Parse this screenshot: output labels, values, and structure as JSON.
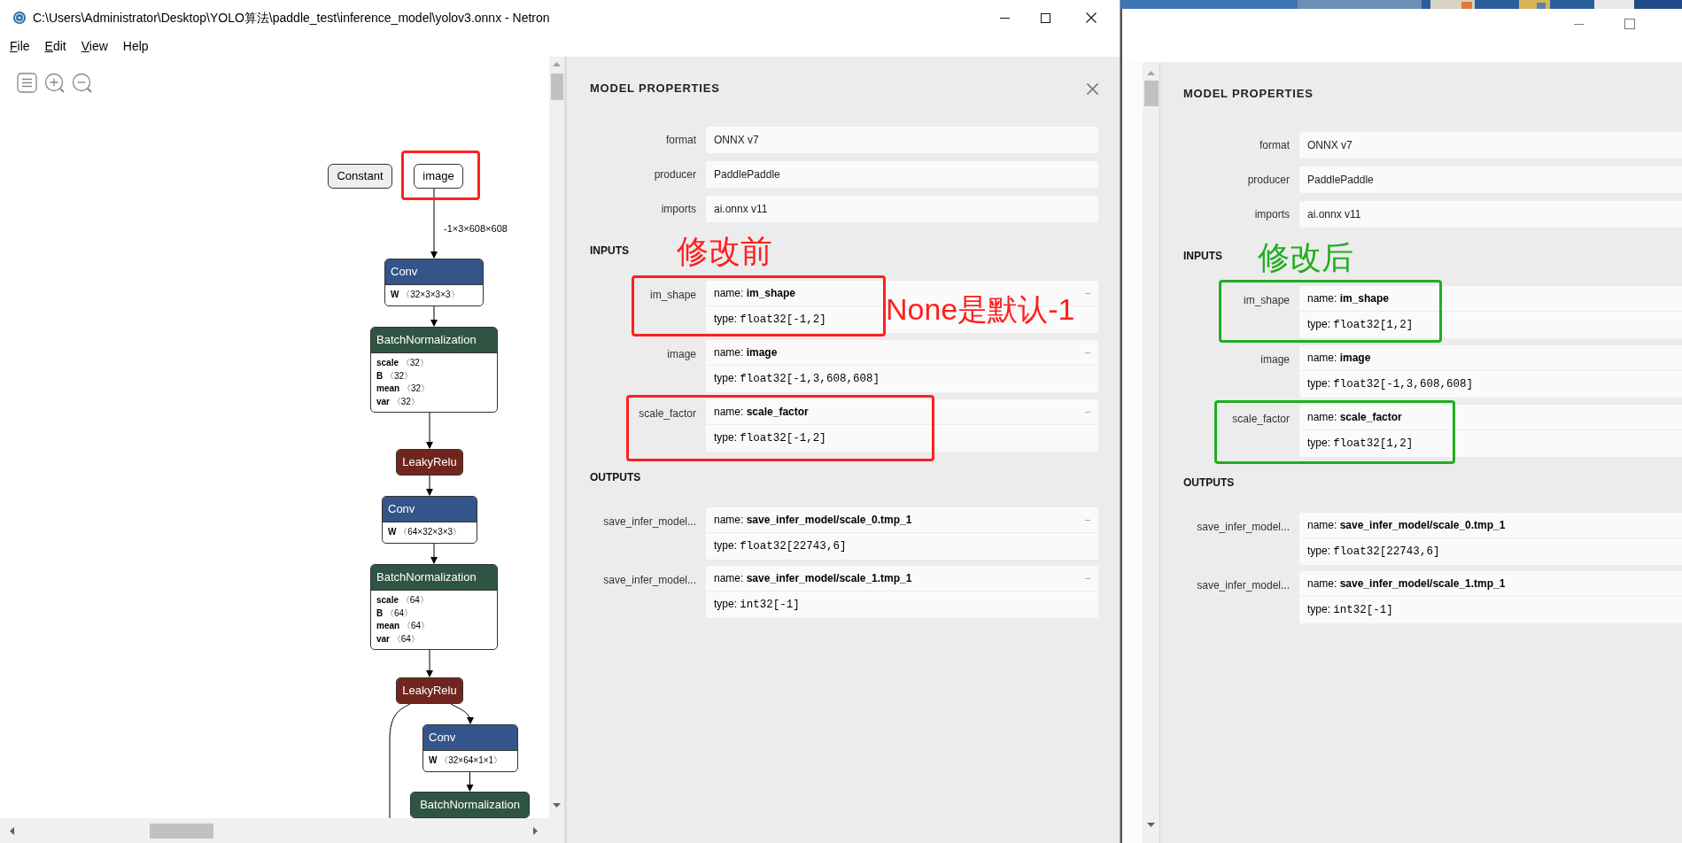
{
  "left_window": {
    "title": "C:\\Users\\Administrator\\Desktop\\YOLO算法\\paddle_test\\inference_model\\yolov3.onnx - Netron",
    "menu": [
      {
        "label": "File",
        "underlined": true
      },
      {
        "label": "Edit",
        "underlined": true
      },
      {
        "label": "View",
        "underlined": true
      },
      {
        "label": "Help",
        "underlined": false
      }
    ],
    "graph": {
      "nodes": [
        {
          "kind": "constant",
          "label": "Constant"
        },
        {
          "kind": "input",
          "label": "image",
          "output_label": "-1×3×608×608"
        },
        {
          "kind": "op",
          "color": "#34548a",
          "label": "Conv",
          "attributes": [
            {
              "name": "W",
              "value": "〈32×3×3×3〉"
            }
          ]
        },
        {
          "kind": "op",
          "color": "#2f5443",
          "label": "BatchNormalization",
          "attributes": [
            {
              "name": "scale",
              "value": "〈32〉"
            },
            {
              "name": "B",
              "value": "〈32〉"
            },
            {
              "name": "mean",
              "value": "〈32〉"
            },
            {
              "name": "var",
              "value": "〈32〉"
            }
          ]
        },
        {
          "kind": "op",
          "color": "#70261f",
          "label": "LeakyRelu"
        },
        {
          "kind": "op",
          "color": "#34548a",
          "label": "Conv",
          "attributes": [
            {
              "name": "W",
              "value": "〈64×32×3×3〉"
            }
          ]
        },
        {
          "kind": "op",
          "color": "#2f5443",
          "label": "BatchNormalization",
          "attributes": [
            {
              "name": "scale",
              "value": "〈64〉"
            },
            {
              "name": "B",
              "value": "〈64〉"
            },
            {
              "name": "mean",
              "value": "〈64〉"
            },
            {
              "name": "var",
              "value": "〈64〉"
            }
          ]
        },
        {
          "kind": "op",
          "color": "#70261f",
          "label": "LeakyRelu"
        },
        {
          "kind": "op",
          "color": "#34548a",
          "label": "Conv",
          "attributes": [
            {
              "name": "W",
              "value": "〈32×64×1×1〉"
            }
          ]
        },
        {
          "kind": "op",
          "color": "#2f5443",
          "label": "BatchNormalization"
        }
      ]
    },
    "properties": {
      "title": "MODEL PROPERTIES",
      "metadata": [
        {
          "label": "format",
          "value": "ONNX v7"
        },
        {
          "label": "producer",
          "value": "PaddlePaddle"
        },
        {
          "label": "imports",
          "value": "ai.onnx v11"
        }
      ],
      "inputs_heading": "INPUTS",
      "inputs": [
        {
          "label": "im_shape",
          "name_label": "name:",
          "name": "im_shape",
          "type_label": "type:",
          "type": "float32[-1,2]",
          "marked": true
        },
        {
          "label": "image",
          "name_label": "name:",
          "name": "image",
          "type_label": "type:",
          "type": "float32[-1,3,608,608]",
          "marked": false
        },
        {
          "label": "scale_factor",
          "name_label": "name:",
          "name": "scale_factor",
          "type_label": "type:",
          "type": "float32[-1,2]",
          "marked": true
        }
      ],
      "outputs_heading": "OUTPUTS",
      "outputs": [
        {
          "label": "save_infer_model...",
          "name_label": "name:",
          "name": "save_infer_model/scale_0.tmp_1",
          "type_label": "type:",
          "type": "float32[22743,6]"
        },
        {
          "label": "save_infer_model...",
          "name_label": "name:",
          "name": "save_infer_model/scale_1.tmp_1",
          "type_label": "type:",
          "type": "int32[-1]"
        }
      ]
    },
    "annotations": [
      {
        "kind": "text",
        "text": "修改前",
        "color": "#ff1f1f"
      },
      {
        "kind": "text",
        "text": "None是默认-1",
        "color": "#ff1f1f"
      },
      {
        "kind": "frame",
        "color": "#ff1f1f"
      }
    ]
  },
  "right_window": {
    "properties": {
      "title": "MODEL PROPERTIES",
      "metadata": [
        {
          "label": "format",
          "value": "ONNX v7"
        },
        {
          "label": "producer",
          "value": "PaddlePaddle"
        },
        {
          "label": "imports",
          "value": "ai.onnx v11"
        }
      ],
      "inputs_heading": "INPUTS",
      "inputs": [
        {
          "label": "im_shape",
          "name_label": "name:",
          "name": "im_shape",
          "type_label": "type:",
          "type": "float32[1,2]",
          "marked": true
        },
        {
          "label": "image",
          "name_label": "name:",
          "name": "image",
          "type_label": "type:",
          "type": "float32[-1,3,608,608]",
          "marked": false
        },
        {
          "label": "scale_factor",
          "name_label": "name:",
          "name": "scale_factor",
          "type_label": "type:",
          "type": "float32[1,2]",
          "marked": true
        }
      ],
      "outputs_heading": "OUTPUTS",
      "outputs": [
        {
          "label": "save_infer_model...",
          "name_label": "name:",
          "name": "save_infer_model/scale_0.tmp_1",
          "type_label": "type:",
          "type": "float32[22743,6]"
        },
        {
          "label": "save_infer_model...",
          "name_label": "name:",
          "name": "save_infer_model/scale_1.tmp_1",
          "type_label": "type:",
          "type": "int32[-1]"
        }
      ]
    },
    "annotations": [
      {
        "kind": "text",
        "text": "修改后",
        "color": "#1fae1f"
      }
    ]
  }
}
